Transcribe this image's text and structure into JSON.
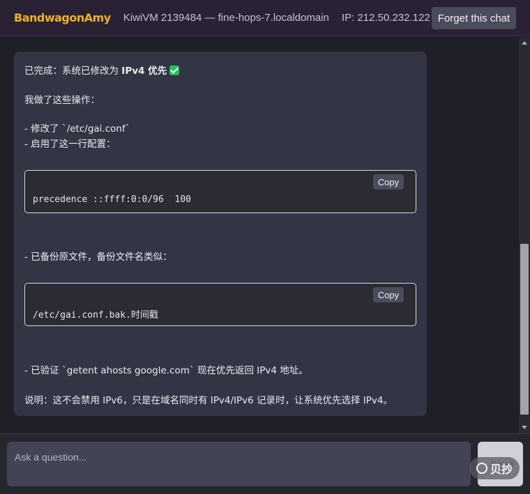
{
  "header": {
    "brand": "BandwagonAmy",
    "host": "KiwiVM 2139484 — fine-hops-7.localdomain",
    "ip": "IP: 212.50.232.122",
    "forget_label": "Forget this chat"
  },
  "message": {
    "done_prefix": "已完成：系统已修改为 ",
    "done_bold": "IPv4 优先",
    "ops_intro": "我做了这些操作：",
    "op1": "- 修改了 `/etc/gai.conf`",
    "op2": "- 启用了这一行配置：",
    "code1": "precedence ::ffff:0:0/96  100",
    "op3": "- 已备份原文件，备份文件名类似：",
    "code2": "/etc/gai.conf.bak.时间戳",
    "op4": "- 已验证 `getent ahosts google.com` 现在优先返回 IPv4 地址。",
    "note": "说明：这不会禁用 IPv6，只是在域名同时有 IPv4/IPv6 记录时，让系统优先选择 IPv4。",
    "copy_label": "Copy"
  },
  "composer": {
    "placeholder": "Ask a question...",
    "send_label": "Send"
  },
  "watermark": {
    "text": "贝抄"
  },
  "colors": {
    "brand": "#f2b027",
    "check": "#22c35e",
    "message_bg": "#333545",
    "code_bg": "#2b2b33"
  }
}
